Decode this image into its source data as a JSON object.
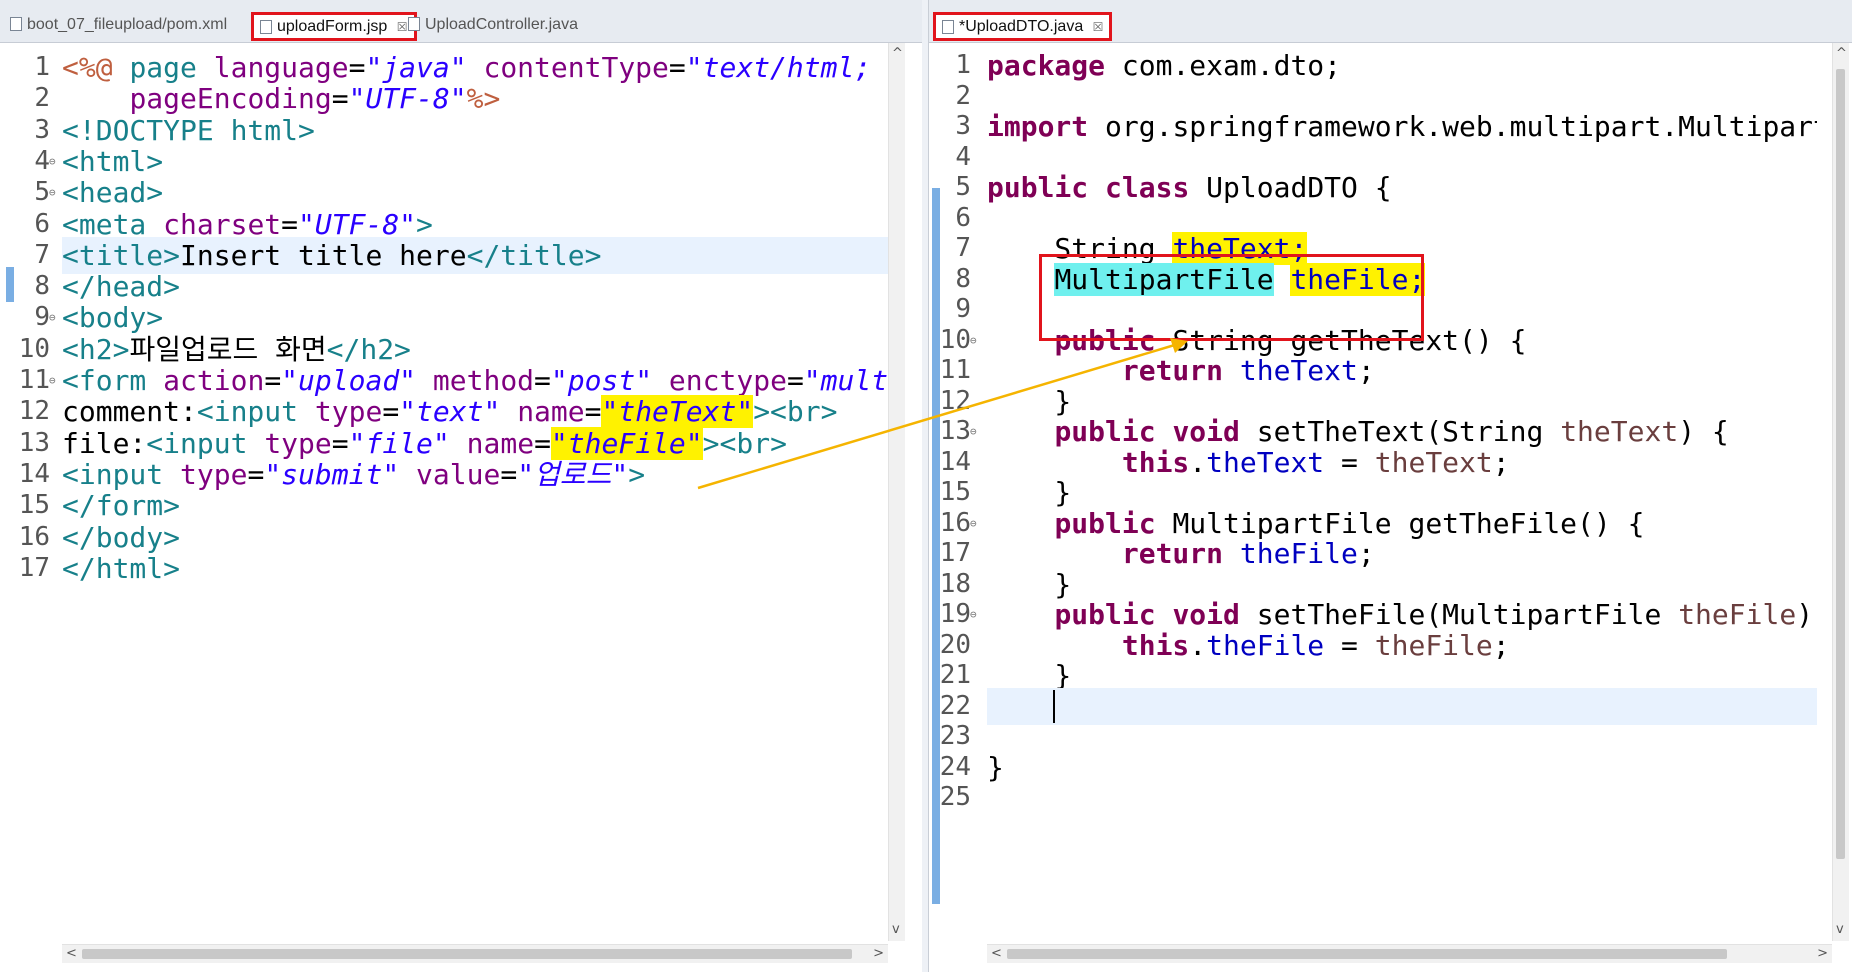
{
  "left_tabs": [
    {
      "label": "boot_07_fileupload/pom.xml",
      "active": false,
      "close": ""
    },
    {
      "label": "uploadForm.jsp",
      "active": true,
      "close": "☒"
    },
    {
      "label": "UploadController.java",
      "active": false,
      "close": ""
    }
  ],
  "right_tabs": [
    {
      "label": "*UploadDTO.java",
      "active": true,
      "close": "☒"
    }
  ],
  "left_code": {
    "current_line": 7,
    "lines": [
      {
        "n": "1",
        "fold": false,
        "tokens": [
          [
            "dir",
            "<%@ "
          ],
          [
            "tag",
            "page "
          ],
          [
            "attr",
            "language"
          ],
          [
            "",
            "="
          ],
          [
            "str",
            "\"java\""
          ],
          [
            "",
            " "
          ],
          [
            "attr",
            "contentType"
          ],
          [
            "",
            "="
          ],
          [
            "str",
            "\"text/html; cha"
          ]
        ]
      },
      {
        "n": "2",
        "fold": false,
        "tokens": [
          [
            "",
            "    "
          ],
          [
            "attr",
            "pageEncoding"
          ],
          [
            "",
            "="
          ],
          [
            "str",
            "\"UTF-8\""
          ],
          [
            "dir",
            "%>"
          ]
        ]
      },
      {
        "n": "3",
        "fold": false,
        "tokens": [
          [
            "tag",
            "<!DOCTYPE html>"
          ]
        ]
      },
      {
        "n": "4",
        "fold": true,
        "tokens": [
          [
            "tag",
            "<html>"
          ]
        ]
      },
      {
        "n": "5",
        "fold": true,
        "tokens": [
          [
            "tag",
            "<head>"
          ]
        ]
      },
      {
        "n": "6",
        "fold": false,
        "tokens": [
          [
            "tag",
            "<meta "
          ],
          [
            "attr",
            "charset"
          ],
          [
            "",
            "="
          ],
          [
            "str",
            "\"UTF-8\""
          ],
          [
            "tag",
            ">"
          ]
        ]
      },
      {
        "n": "7",
        "fold": false,
        "tokens": [
          [
            "tag",
            "<title>"
          ],
          [
            "",
            "Insert title here"
          ],
          [
            "tag",
            "</title>"
          ]
        ]
      },
      {
        "n": "8",
        "fold": false,
        "tokens": [
          [
            "tag",
            "</head>"
          ]
        ]
      },
      {
        "n": "9",
        "fold": true,
        "tokens": [
          [
            "tag",
            "<body>"
          ]
        ]
      },
      {
        "n": "10",
        "fold": false,
        "tokens": [
          [
            "tag",
            "<h2>"
          ],
          [
            "",
            "파일업로드 화면"
          ],
          [
            "tag",
            "</h2>"
          ]
        ]
      },
      {
        "n": "11",
        "fold": true,
        "tokens": [
          [
            "tag",
            "<form "
          ],
          [
            "attr",
            "action"
          ],
          [
            "",
            "="
          ],
          [
            "str",
            "\"upload\""
          ],
          [
            "",
            " "
          ],
          [
            "attr",
            "method"
          ],
          [
            "",
            "="
          ],
          [
            "str",
            "\"post\""
          ],
          [
            "",
            " "
          ],
          [
            "attr",
            "enctype"
          ],
          [
            "",
            "="
          ],
          [
            "str",
            "\"multipa"
          ]
        ]
      },
      {
        "n": "12",
        "fold": false,
        "tokens": [
          [
            "",
            "comment:"
          ],
          [
            "tag",
            "<input "
          ],
          [
            "attr",
            "type"
          ],
          [
            "",
            "="
          ],
          [
            "str",
            "\"text\""
          ],
          [
            "",
            " "
          ],
          [
            "attr",
            "name"
          ],
          [
            "",
            "="
          ],
          [
            "str hl-y",
            "\"theText\""
          ],
          [
            "tag",
            "><br>"
          ]
        ]
      },
      {
        "n": "13",
        "fold": false,
        "tokens": [
          [
            "",
            "file:"
          ],
          [
            "tag",
            "<input "
          ],
          [
            "attr",
            "type"
          ],
          [
            "",
            "="
          ],
          [
            "str",
            "\"file\""
          ],
          [
            "",
            " "
          ],
          [
            "attr",
            "name"
          ],
          [
            "",
            "="
          ],
          [
            "str hl-y",
            "\"theFile\""
          ],
          [
            "tag",
            "><br>"
          ]
        ]
      },
      {
        "n": "14",
        "fold": false,
        "tokens": [
          [
            "tag",
            "<input "
          ],
          [
            "attr",
            "type"
          ],
          [
            "",
            "="
          ],
          [
            "str",
            "\"submit\""
          ],
          [
            "",
            " "
          ],
          [
            "attr",
            "value"
          ],
          [
            "",
            "="
          ],
          [
            "str",
            "\"업로드\""
          ],
          [
            "tag",
            ">"
          ]
        ]
      },
      {
        "n": "15",
        "fold": false,
        "tokens": [
          [
            "tag",
            "</form>"
          ]
        ]
      },
      {
        "n": "16",
        "fold": false,
        "tokens": [
          [
            "tag",
            "</body>"
          ]
        ]
      },
      {
        "n": "17",
        "fold": false,
        "tokens": [
          [
            "tag",
            "</html>"
          ]
        ]
      }
    ]
  },
  "right_code": {
    "current_line": 22,
    "lines": [
      {
        "n": "1",
        "fold": false,
        "tokens": [
          [
            "kw",
            "package"
          ],
          [
            "",
            " com.exam.dto;"
          ]
        ]
      },
      {
        "n": "2",
        "fold": false,
        "tokens": []
      },
      {
        "n": "3",
        "fold": false,
        "tokens": [
          [
            "kw",
            "import"
          ],
          [
            "",
            " org.springframework.web.multipart.MultipartFi"
          ]
        ]
      },
      {
        "n": "4",
        "fold": false,
        "tokens": []
      },
      {
        "n": "5",
        "fold": false,
        "tokens": [
          [
            "kw",
            "public"
          ],
          [
            "",
            " "
          ],
          [
            "kw",
            "class"
          ],
          [
            "",
            " UploadDTO {"
          ]
        ]
      },
      {
        "n": "6",
        "fold": false,
        "tokens": []
      },
      {
        "n": "7",
        "fold": false,
        "tokens": [
          [
            "",
            "    String "
          ],
          [
            "fld hl-y",
            "theText;"
          ]
        ]
      },
      {
        "n": "8",
        "fold": false,
        "tokens": [
          [
            "",
            "    "
          ],
          [
            "hl-c",
            "MultipartFile"
          ],
          [
            "",
            " "
          ],
          [
            "fld hl-y",
            "theFile;"
          ]
        ]
      },
      {
        "n": "9",
        "fold": false,
        "tokens": []
      },
      {
        "n": "10",
        "fold": true,
        "tokens": [
          [
            "",
            "    "
          ],
          [
            "kw",
            "public"
          ],
          [
            "",
            " String getTheText() {"
          ]
        ]
      },
      {
        "n": "11",
        "fold": false,
        "tokens": [
          [
            "",
            "        "
          ],
          [
            "kw",
            "return"
          ],
          [
            "",
            " "
          ],
          [
            "fld",
            "theText"
          ],
          [
            "",
            ";"
          ]
        ]
      },
      {
        "n": "12",
        "fold": false,
        "tokens": [
          [
            "",
            "    }"
          ]
        ]
      },
      {
        "n": "13",
        "fold": true,
        "tokens": [
          [
            "",
            "    "
          ],
          [
            "kw",
            "public"
          ],
          [
            "",
            " "
          ],
          [
            "kw",
            "void"
          ],
          [
            "",
            " setTheText(String "
          ],
          [
            "prm",
            "theText"
          ],
          [
            "",
            ") {"
          ]
        ]
      },
      {
        "n": "14",
        "fold": false,
        "tokens": [
          [
            "",
            "        "
          ],
          [
            "kw",
            "this"
          ],
          [
            "",
            "."
          ],
          [
            "fld",
            "theText"
          ],
          [
            "",
            " = "
          ],
          [
            "prm",
            "theText"
          ],
          [
            "",
            ";"
          ]
        ]
      },
      {
        "n": "15",
        "fold": false,
        "tokens": [
          [
            "",
            "    }"
          ]
        ]
      },
      {
        "n": "16",
        "fold": true,
        "tokens": [
          [
            "",
            "    "
          ],
          [
            "kw",
            "public"
          ],
          [
            "",
            " MultipartFile getTheFile() {"
          ]
        ]
      },
      {
        "n": "17",
        "fold": false,
        "tokens": [
          [
            "",
            "        "
          ],
          [
            "kw",
            "return"
          ],
          [
            "",
            " "
          ],
          [
            "fld",
            "theFile"
          ],
          [
            "",
            ";"
          ]
        ]
      },
      {
        "n": "18",
        "fold": false,
        "tokens": [
          [
            "",
            "    }"
          ]
        ]
      },
      {
        "n": "19",
        "fold": true,
        "tokens": [
          [
            "",
            "    "
          ],
          [
            "kw",
            "public"
          ],
          [
            "",
            " "
          ],
          [
            "kw",
            "void"
          ],
          [
            "",
            " setTheFile(MultipartFile "
          ],
          [
            "prm",
            "theFile"
          ],
          [
            "",
            ") {"
          ]
        ]
      },
      {
        "n": "20",
        "fold": false,
        "tokens": [
          [
            "",
            "        "
          ],
          [
            "kw",
            "this"
          ],
          [
            "",
            "."
          ],
          [
            "fld",
            "theFile"
          ],
          [
            "",
            " = "
          ],
          [
            "prm",
            "theFile"
          ],
          [
            "",
            ";"
          ]
        ]
      },
      {
        "n": "21",
        "fold": false,
        "tokens": [
          [
            "",
            "    }"
          ]
        ]
      },
      {
        "n": "22",
        "fold": false,
        "tokens": []
      },
      {
        "n": "23",
        "fold": false,
        "tokens": []
      },
      {
        "n": "24",
        "fold": false,
        "tokens": [
          [
            "",
            "}"
          ]
        ]
      },
      {
        "n": "25",
        "fold": false,
        "tokens": []
      }
    ]
  },
  "scroll_glyphs": {
    "up": "^",
    "down": "v",
    "left": "<",
    "right": ">"
  },
  "fold_glyph": "⊖",
  "colors": {
    "highlight_box": "#e1141c",
    "arrow": "#f5b400",
    "highlight_yellow": "#fff200",
    "highlight_cyan": "#6ff0ee"
  }
}
